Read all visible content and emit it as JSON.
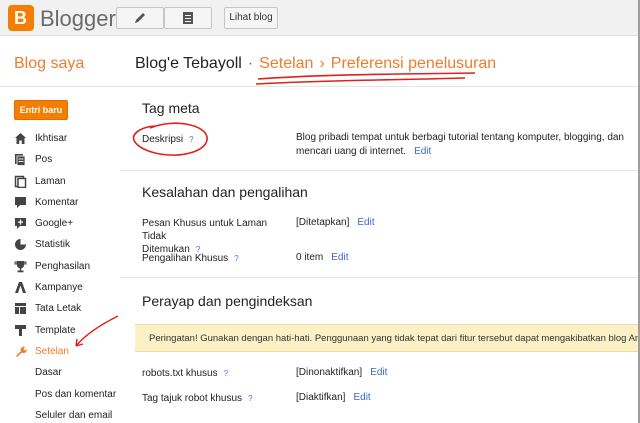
{
  "app": {
    "brand": "Blogger",
    "view_blog_label": "Lihat blog"
  },
  "header": {
    "my_blogs": "Blog saya",
    "blog_name": "Blog'e Tebayoll",
    "separator1": "·",
    "settings": "Setelan",
    "separator2": "›",
    "search_prefs": "Preferensi penelusuran"
  },
  "sidebar": {
    "new_post": "Entri baru",
    "items": [
      {
        "label": "Ikhtisar",
        "icon": "home-icon"
      },
      {
        "label": "Pos",
        "icon": "posts-icon"
      },
      {
        "label": "Laman",
        "icon": "pages-icon"
      },
      {
        "label": "Komentar",
        "icon": "comments-icon"
      },
      {
        "label": "Google+",
        "icon": "google-plus-icon"
      },
      {
        "label": "Statistik",
        "icon": "stats-icon"
      },
      {
        "label": "Penghasilan",
        "icon": "trophy-icon"
      },
      {
        "label": "Kampanye",
        "icon": "campaigns-icon"
      },
      {
        "label": "Tata Letak",
        "icon": "layout-icon"
      },
      {
        "label": "Template",
        "icon": "template-icon"
      },
      {
        "label": "Setelan",
        "icon": "wrench-icon"
      }
    ],
    "subitems": [
      "Dasar",
      "Pos dan komentar",
      "Seluler dan email"
    ]
  },
  "main": {
    "meta": {
      "title": "Tag meta",
      "desc_label": "Deskripsi",
      "help": "?",
      "desc_value_line1": "Blog pribadi tempat untuk berbagi tutorial tentang komputer, blogging, dan",
      "desc_value_line2": "mencari uang di internet.",
      "edit": "Edit"
    },
    "errors": {
      "title": "Kesalahan dan pengalihan",
      "notfound_label_line1": "Pesan Khusus untuk Laman Tidak",
      "notfound_label_line2": "Ditemukan",
      "notfound_value": "[Ditetapkan]",
      "redirect_label": "Pengalihan Khusus",
      "redirect_value": "0 item",
      "help": "?",
      "edit": "Edit"
    },
    "crawl": {
      "title": "Perayap dan pengindeksan",
      "warning": "Peringatan! Gunakan dengan hati-hati. Penggunaan yang tidak tepat dari fitur tersebut dapat mengakibatkan blog Anda di",
      "robots_label": "robots.txt khusus",
      "robots_value": "[Dinonaktifkan]",
      "robot_tags_label": "Tag tajuk robot khusus",
      "robot_tags_value": "[Diaktifkan]",
      "help": "?",
      "edit": "Edit"
    }
  },
  "colors": {
    "accent": "#ef7c2d",
    "link": "#3c68c9",
    "annotation": "#e0201b"
  }
}
